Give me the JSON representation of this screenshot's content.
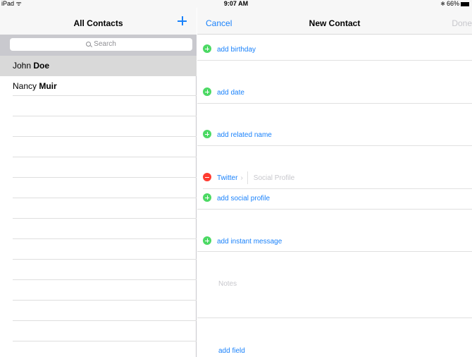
{
  "status": {
    "left": "iPad",
    "time": "9:07 AM",
    "battery": "66%"
  },
  "contacts": {
    "title": "All Contacts",
    "search_placeholder": "Search",
    "items": [
      {
        "first": "John",
        "last": "Doe",
        "selected": true
      },
      {
        "first": "Nancy",
        "last": "Muir",
        "selected": false
      }
    ]
  },
  "new_contact": {
    "cancel": "Cancel",
    "title": "New Contact",
    "done": "Done",
    "add_birthday": "add birthday",
    "add_date": "add date",
    "add_related_name": "add related name",
    "social_type": "Twitter",
    "social_placeholder": "Social Profile",
    "add_social_profile": "add social profile",
    "add_instant_message": "add instant message",
    "notes": "Notes",
    "add_field": "add field"
  },
  "colors": {
    "accent": "#1a82fb",
    "add": "#4cd964",
    "delete": "#ff3b30"
  }
}
